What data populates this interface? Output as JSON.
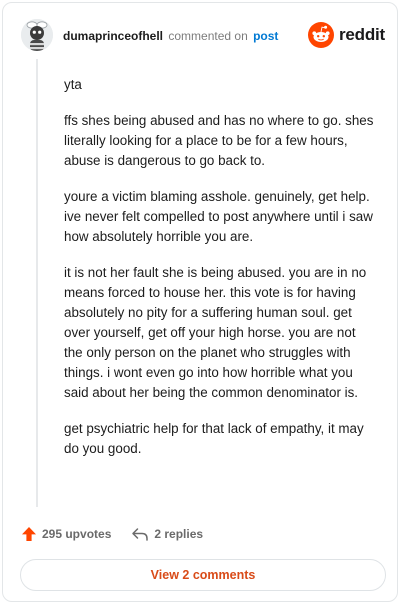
{
  "comment": {
    "username": "dumaprinceofhell",
    "action_text": "commented on",
    "post_link": "post",
    "paragraphs": [
      "yta",
      "ffs shes being abused and has no where to go. shes literally looking for a place to be for a few hours, abuse is dangerous to go back to.",
      "youre a victim blaming asshole. genuinely, get help. ive never felt compelled to post anywhere until i saw how absolutely horrible you are.",
      "it is not her fault she is being abused. you are in no means forced to house her. this vote is for having absolutely no pity for a suffering human soul. get over yourself, get off your high horse. you are not the only person on the planet who struggles with things. i wont even go into how horrible what you said about her being the common denominator is.",
      "get psychiatric help for that lack of empathy, it may do you good."
    ]
  },
  "brand": {
    "wordmark": "reddit",
    "icon": "reddit-snoo-icon",
    "color": "#ff4500"
  },
  "actions": {
    "upvotes": "295 upvotes",
    "upvote_icon": "upvote-arrow-icon",
    "upvote_color": "#ff4500",
    "replies": "2 replies",
    "reply_icon": "reply-arrow-icon"
  },
  "footer": {
    "view_comments_label": "View 2 comments",
    "label_color": "#d94b18"
  }
}
